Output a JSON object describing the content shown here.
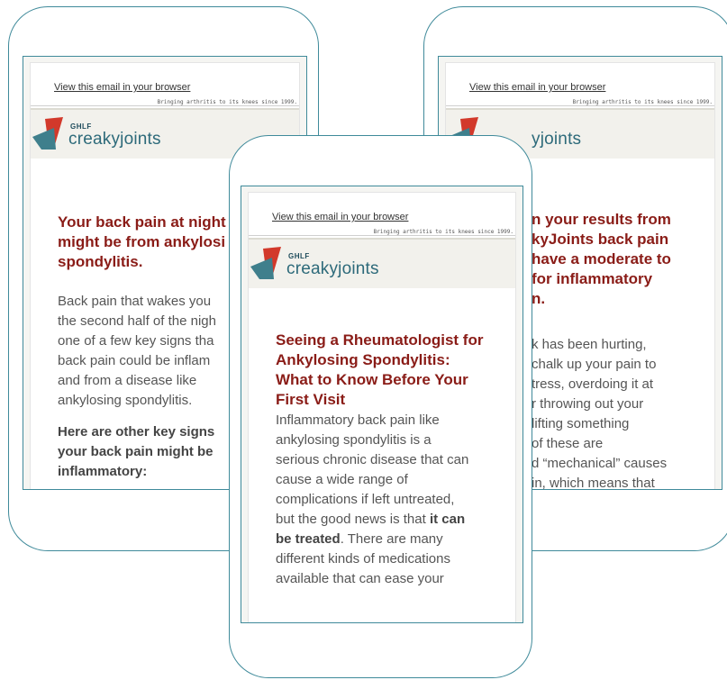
{
  "email_common": {
    "view_in_browser": "View this email in your browser",
    "tagline": "Bringing arthritis to its knees since 1999.",
    "brand_ghlf": "GHLF",
    "brand_name": "creakyjoints",
    "colors": {
      "frame": "#3f8a9a",
      "headline": "#8a1c17",
      "brand": "#2d6a7a",
      "flag_red": "#d2392b",
      "flag_teal": "#3f7f8c"
    }
  },
  "left_email": {
    "headline_lines": [
      "Your back pain at night",
      "might be from ankylosi",
      "spondylitis."
    ],
    "body_lines": [
      "Back pain that wakes you",
      "the second half of the nigh",
      "one of a few key signs tha",
      "back pain could be inflam",
      "and from a disease like",
      "ankylosing spondylitis."
    ],
    "subhead_lines": [
      "Here are other key signs",
      "your back pain might be",
      "inflammatory:"
    ]
  },
  "right_email": {
    "brand_name_fragment": "yjoints",
    "headline_lines": [
      "n your results from",
      "kyJoints back pain",
      "have a moderate to",
      "for inflammatory",
      "n."
    ],
    "body_lines": [
      "k has been hurting,",
      "chalk up your pain to",
      "tress, overdoing it at",
      "r throwing out your",
      "lifting something",
      "of these are",
      "d “mechanical” causes",
      "in, which means that"
    ]
  },
  "center_email": {
    "headline_lines": [
      "Seeing a Rheumatologist for",
      "Ankylosing Spondylitis:",
      "What to Know Before Your",
      "First Visit"
    ],
    "body": {
      "l1": "Inflammatory back pain like",
      "l2": "ankylosing spondylitis is a",
      "l3": "serious chronic disease that can",
      "l4": "cause a wide range of",
      "l5": "complications if left untreated,",
      "l6a": "but the good news is that ",
      "l6b": "it can",
      "l7a": "be treated",
      "l7b": ". There are many",
      "l8": "different kinds of medications",
      "l9": "available that can ease your"
    }
  }
}
